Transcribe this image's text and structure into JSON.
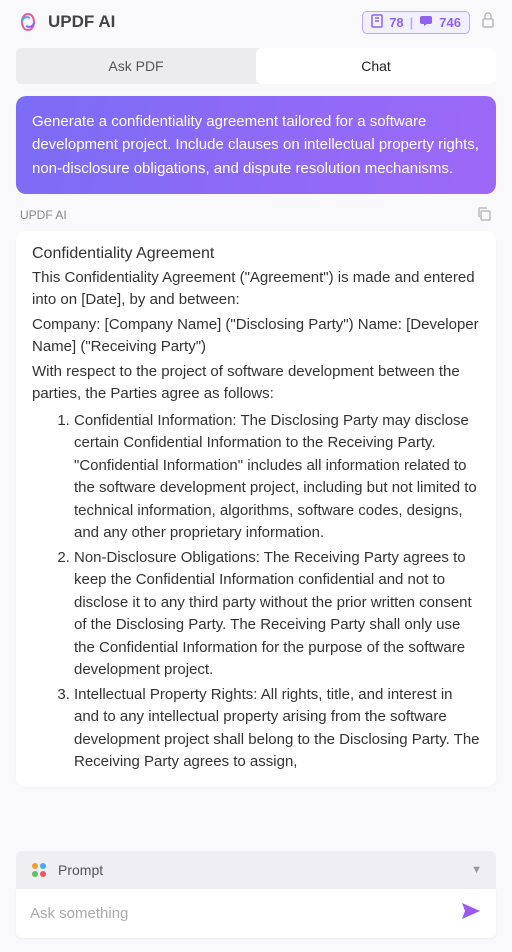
{
  "header": {
    "title": "UPDF AI",
    "badge1": "78",
    "badge2": "746"
  },
  "tabs": {
    "askpdf": "Ask PDF",
    "chat": "Chat"
  },
  "userMessage": "Generate a confidentiality agreement tailored for a software development project. Include clauses on intellectual property rights, non-disclosure obligations, and dispute resolution mechanisms.",
  "aiLabel": "UPDF AI",
  "response": {
    "title": "Confidentiality Agreement",
    "p1": "This Confidentiality Agreement (\"Agreement\") is made and entered into on [Date], by and between:",
    "p2": "Company: [Company Name] (\"Disclosing Party\") Name: [Developer Name] (\"Receiving Party\")",
    "p3": "With respect to the project of software development between the parties, the Parties agree as follows:",
    "items": [
      "Confidential Information: The Disclosing Party may disclose certain Confidential Information to the Receiving Party. \"Confidential Information\" includes all information related to the software development project, including but not limited to technical information, algorithms, software codes, designs, and any other proprietary information.",
      "Non-Disclosure Obligations: The Receiving Party agrees to keep the Confidential Information confidential and not to disclose it to any third party without the prior written consent of the Disclosing Party. The Receiving Party shall only use the Confidential Information for the purpose of the software development project.",
      "Intellectual Property Rights: All rights, title, and interest in and to any intellectual property arising from the software development project shall belong to the Disclosing Party. The Receiving Party agrees to assign,"
    ]
  },
  "prompt": {
    "label": "Prompt"
  },
  "input": {
    "placeholder": "Ask something"
  }
}
